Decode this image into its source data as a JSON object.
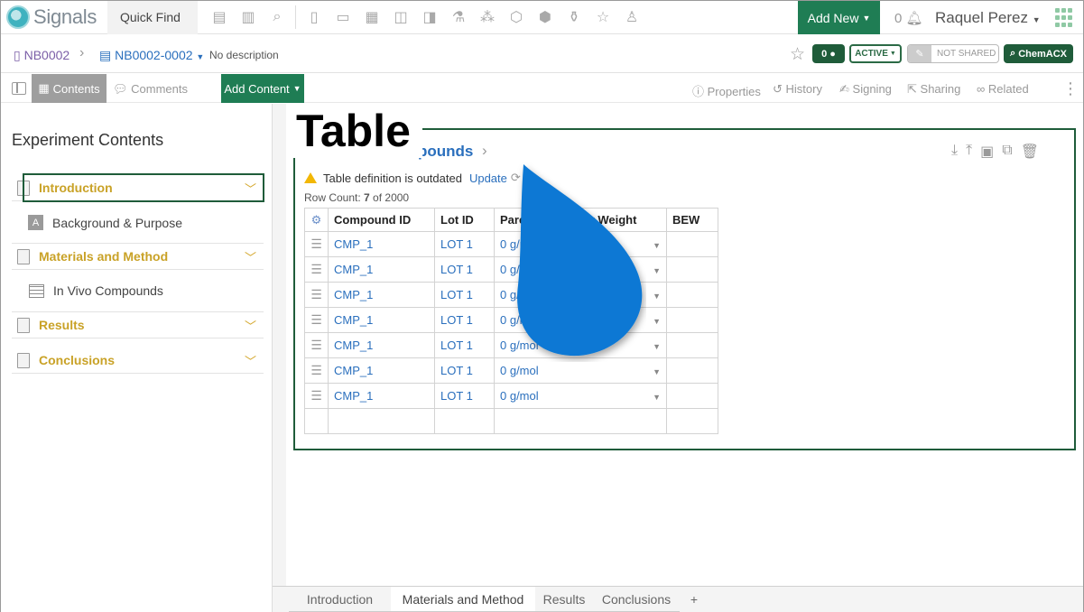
{
  "app": {
    "logo_text": "Signals",
    "quick_find": "Quick Find",
    "add_new": "Add New",
    "notif_count": "0",
    "user": "Raquel Perez"
  },
  "breadcrumb": {
    "notebook": "NB0002",
    "experiment": "NB0002-0002",
    "description": "No description"
  },
  "badges": {
    "comments": "0",
    "status": "ACTIVE",
    "shared": "NOT SHARED",
    "chemacx": "ChemACX"
  },
  "toolbar": {
    "contents": "Contents",
    "comments": "Comments",
    "add_content": "Add Content",
    "properties": "Properties",
    "history": "History",
    "signing": "Signing",
    "sharing": "Sharing",
    "related": "Related"
  },
  "left": {
    "title": "Experiment Contents",
    "sections": [
      {
        "label": "Introduction",
        "child": "Background & Purpose"
      },
      {
        "label": "Materials and Method",
        "child": "In Vivo Compounds"
      },
      {
        "label": "Results"
      },
      {
        "label": "Conclusions"
      }
    ]
  },
  "card": {
    "overlay_label": "Table",
    "title_partial": "pounds",
    "warning": "Table definition is outdated",
    "update": "Update",
    "row_count_prefix": "Row Count: ",
    "row_count": "7",
    "row_count_suffix": " of 2000"
  },
  "table": {
    "headers": [
      "Compound ID",
      "Lot ID",
      "Parent Molecular Weight",
      "BEW"
    ],
    "rows": [
      {
        "compound": "CMP_1",
        "lot": "LOT 1",
        "weight": "0 g/mol",
        "bew": ""
      },
      {
        "compound": "CMP_1",
        "lot": "LOT 1",
        "weight": "0 g/mol",
        "bew": ""
      },
      {
        "compound": "CMP_1",
        "lot": "LOT 1",
        "weight": "0 g/mol",
        "bew": ""
      },
      {
        "compound": "CMP_1",
        "lot": "LOT 1",
        "weight": "0 g/mol",
        "bew": ""
      },
      {
        "compound": "CMP_1",
        "lot": "LOT 1",
        "weight": "0 g/mol",
        "bew": ""
      },
      {
        "compound": "CMP_1",
        "lot": "LOT 1",
        "weight": "0 g/mol",
        "bew": ""
      },
      {
        "compound": "CMP_1",
        "lot": "LOT 1",
        "weight": "0 g/mol",
        "bew": ""
      }
    ]
  },
  "bottom_tabs": [
    "Introduction",
    "Materials and Method",
    "Results",
    "Conclusions",
    "+"
  ],
  "colors": {
    "brand_green": "#1f7d54",
    "dark_green": "#1f5c3a",
    "link_blue": "#2a6fbd",
    "section_gold": "#c9a227",
    "drop_blue": "#0a78d4"
  }
}
